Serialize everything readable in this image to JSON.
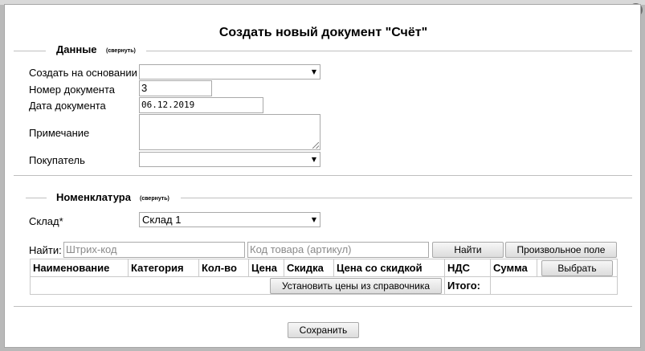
{
  "dialog": {
    "title": "Создать новый документ \"Счёт\"",
    "close_glyph": "×"
  },
  "data_section": {
    "legend": "Данные",
    "toggle": "(свернуть)",
    "fields": {
      "based_on_label": "Создать на основании",
      "based_on_value": "",
      "doc_number_label": "Номер документа",
      "doc_number_value": "3",
      "doc_date_label": "Дата документа",
      "doc_date_value": "06.12.2019",
      "note_label": "Примечание",
      "note_value": "",
      "buyer_label": "Покупатель",
      "buyer_value": ""
    }
  },
  "nomenclature_section": {
    "legend": "Номенклатура",
    "toggle": "(свернуть)",
    "warehouse_label": "Склад*",
    "warehouse_value": "Склад 1",
    "find_label": "Найти:",
    "barcode_placeholder": "Штрих-код",
    "article_placeholder": "Код товара (артикул)",
    "find_button": "Найти",
    "custom_field_button": "Произвольное поле",
    "table": {
      "columns": [
        "Наименование",
        "Категория",
        "Кол-во",
        "Цена",
        "Скидка",
        "Цена со скидкой",
        "НДС",
        "Сумма"
      ],
      "select_button": "Выбрать",
      "set_prices_button": "Установить цены из справочника",
      "total_label": "Итого:"
    }
  },
  "footer": {
    "save_button": "Сохранить"
  },
  "icons": {
    "dropdown_arrow": "▼"
  }
}
